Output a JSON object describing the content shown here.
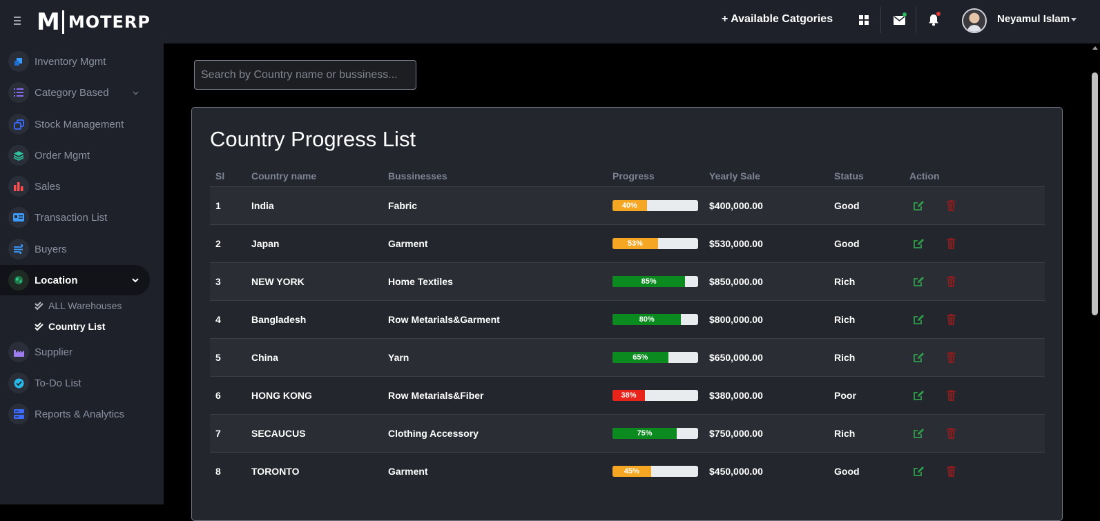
{
  "header": {
    "logo_m": "M",
    "logo_text": "MOTERP",
    "categories_link": "+ Available Catgories",
    "user_name": "Neyamul Islam",
    "icons": {
      "menu": "menu-icon",
      "grid": "grid-icon",
      "mail": "mail-icon",
      "bell": "bell-icon"
    },
    "colors": {
      "mail_dot": "#2fb85a",
      "bell_dot": "#e53935"
    }
  },
  "sidebar": {
    "items": [
      {
        "label": "Inventory Mgmt",
        "icon": "inventory-icon",
        "color": "#3b9cff"
      },
      {
        "label": "Category Based",
        "icon": "list-icon",
        "color": "#8a6cf0"
      },
      {
        "label": "Stock Management",
        "icon": "copy-icon",
        "color": "#3b6cff"
      },
      {
        "label": "Order Mgmt",
        "icon": "layers-icon",
        "color": "#2ec4a0"
      },
      {
        "label": "Sales",
        "icon": "bar-chart-icon",
        "color": "#ff4d4f"
      },
      {
        "label": "Transaction List",
        "icon": "id-card-icon",
        "color": "#3b9cff"
      },
      {
        "label": "Buyers",
        "icon": "wind-icon",
        "color": "#3b9cff"
      },
      {
        "label": "Location",
        "icon": "globe-icon",
        "color": "#2ec48a"
      },
      {
        "label": "Supplier",
        "icon": "factory-icon",
        "color": "#a07cf0"
      },
      {
        "label": "To-Do List",
        "icon": "check-circle-icon",
        "color": "#2ab6e8"
      },
      {
        "label": "Reports & Analytics",
        "icon": "server-icon",
        "color": "#3b6cff"
      }
    ],
    "location_sub": [
      {
        "label": "ALL Warehouses"
      },
      {
        "label": "Country List"
      }
    ]
  },
  "search": {
    "placeholder": "Search by Country name or bussiness..."
  },
  "main": {
    "title": "Country Progress List",
    "columns": [
      "Sl",
      "Country name",
      "Bussinesses",
      "Progress",
      "Yearly Sale",
      "Status",
      "Action"
    ],
    "rows": [
      {
        "sl": "1",
        "country": "India",
        "business": "Fabric",
        "progress": 40,
        "progress_label": "40%",
        "color": "#f5a623",
        "sale": "$400,000.00",
        "status": "Good"
      },
      {
        "sl": "2",
        "country": "Japan",
        "business": "Garment",
        "progress": 53,
        "progress_label": "53%",
        "color": "#f5a623",
        "sale": "$530,000.00",
        "status": "Good"
      },
      {
        "sl": "3",
        "country": "NEW YORK",
        "business": "Home Textiles",
        "progress": 85,
        "progress_label": "85%",
        "color": "#0a8a1f",
        "sale": "$850,000.00",
        "status": "Rich"
      },
      {
        "sl": "4",
        "country": "Bangladesh",
        "business": "Row Metarials&Garment",
        "progress": 80,
        "progress_label": "80%",
        "color": "#0a8a1f",
        "sale": "$800,000.00",
        "status": "Rich"
      },
      {
        "sl": "5",
        "country": "China",
        "business": "Yarn",
        "progress": 65,
        "progress_label": "65%",
        "color": "#0a8a1f",
        "sale": "$650,000.00",
        "status": "Rich"
      },
      {
        "sl": "6",
        "country": "HONG KONG",
        "business": "Row Metarials&Fiber",
        "progress": 38,
        "progress_label": "38%",
        "color": "#e8231a",
        "sale": "$380,000.00",
        "status": "Poor"
      },
      {
        "sl": "7",
        "country": "SECAUCUS",
        "business": "Clothing Accessory",
        "progress": 75,
        "progress_label": "75%",
        "color": "#0a8a1f",
        "sale": "$750,000.00",
        "status": "Rich"
      },
      {
        "sl": "8",
        "country": "TORONTO",
        "business": "Garment",
        "progress": 45,
        "progress_label": "45%",
        "color": "#f5a623",
        "sale": "$450,000.00",
        "status": "Good"
      }
    ],
    "action_colors": {
      "edit": "#2e9e4a",
      "delete": "#8a1e1e"
    }
  }
}
